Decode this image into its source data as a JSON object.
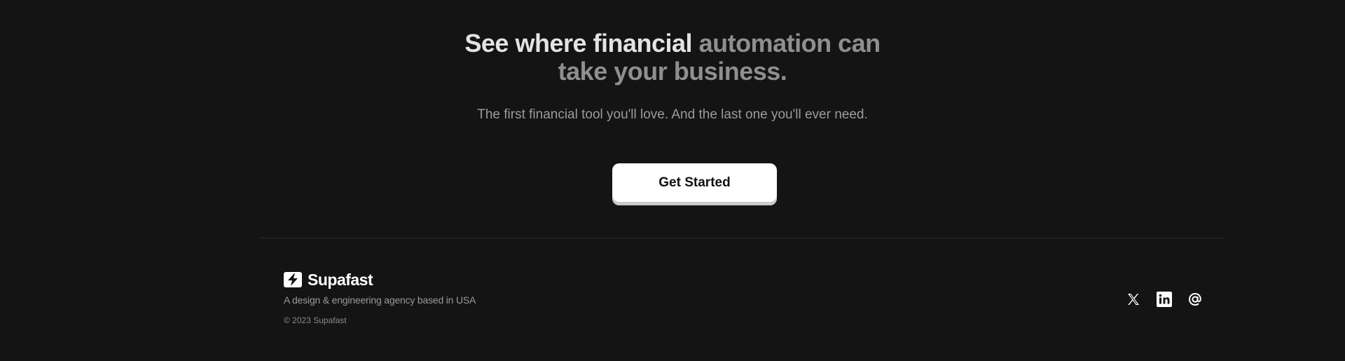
{
  "hero": {
    "headline_bright_1": "See where financial",
    "headline_dim_1": "automation can",
    "headline_dim_2": "take your business.",
    "subtitle": "The first financial tool you'll love. And the last one you'll ever need.",
    "cta_label": "Get Started"
  },
  "footer": {
    "brand_name": "Supafast",
    "brand_logo_icon": "lightning-bolt-logo",
    "tagline": "A design & engineering agency based in USA",
    "copyright": "© 2023 Supafast",
    "socials": [
      {
        "icon": "x-twitter-icon"
      },
      {
        "icon": "linkedin-icon"
      },
      {
        "icon": "at-email-icon"
      }
    ]
  },
  "colors": {
    "background": "#141414",
    "headline_bright": "#e3e3e3",
    "headline_dim": "#8f8f8f",
    "cta_background": "#ffffff",
    "cta_text": "#111111"
  }
}
